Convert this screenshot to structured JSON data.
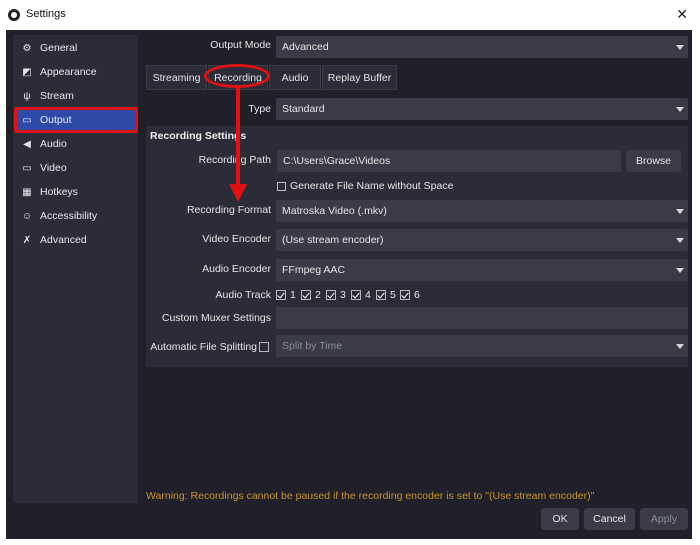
{
  "window": {
    "title": "Settings",
    "close": "✕"
  },
  "sidebar": {
    "items": [
      {
        "label": "General",
        "icon": "gear-icon",
        "glyph": "⚙"
      },
      {
        "label": "Appearance",
        "icon": "appearance-icon",
        "glyph": "◩"
      },
      {
        "label": "Stream",
        "icon": "antenna-icon",
        "glyph": "ψ"
      },
      {
        "label": "Output",
        "icon": "output-icon",
        "glyph": "▭"
      },
      {
        "label": "Audio",
        "icon": "speaker-icon",
        "glyph": "◀"
      },
      {
        "label": "Video",
        "icon": "monitor-icon",
        "glyph": "▭"
      },
      {
        "label": "Hotkeys",
        "icon": "keyboard-icon",
        "glyph": "▦"
      },
      {
        "label": "Accessibility",
        "icon": "accessibility-icon",
        "glyph": "☺"
      },
      {
        "label": "Advanced",
        "icon": "wrench-icon",
        "glyph": "✗"
      }
    ],
    "active": "Output"
  },
  "output_mode": {
    "label": "Output Mode",
    "value": "Advanced"
  },
  "tabs": [
    "Streaming",
    "Recording",
    "Audio",
    "Replay Buffer"
  ],
  "active_tab": "Recording",
  "type": {
    "label": "Type",
    "value": "Standard"
  },
  "recording": {
    "group_title": "Recording Settings",
    "path_label": "Recording Path",
    "path_value": "C:\\Users\\Grace\\Videos",
    "browse": "Browse",
    "gen_filename_label": "Generate File Name without Space",
    "format_label": "Recording Format",
    "format_value": "Matroska Video (.mkv)",
    "video_encoder_label": "Video Encoder",
    "video_encoder_value": "(Use stream encoder)",
    "audio_encoder_label": "Audio Encoder",
    "audio_encoder_value": "FFmpeg AAC",
    "audio_track_label": "Audio Track",
    "audio_tracks": [
      "1",
      "2",
      "3",
      "4",
      "5",
      "6"
    ],
    "muxer_label": "Custom Muxer Settings",
    "muxer_value": "",
    "split_label": "Automatic File Splitting",
    "split_value": "Split by Time"
  },
  "warning": "Warning: Recordings cannot be paused if the recording encoder is set to \"(Use stream encoder)\"",
  "buttons": {
    "ok": "OK",
    "cancel": "Cancel",
    "apply": "Apply"
  },
  "colors": {
    "accent": "#2e4aa8",
    "annotation": "#e01111",
    "warning": "#c99426"
  }
}
